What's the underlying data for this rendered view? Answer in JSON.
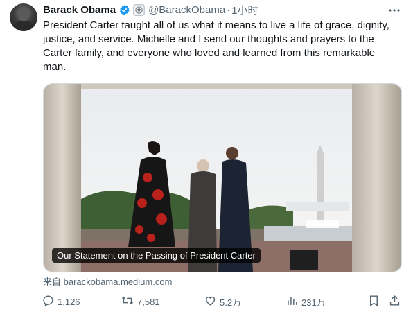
{
  "author": {
    "name": "Barack Obama",
    "handle": "@BarackObama",
    "time": "1小时"
  },
  "tweet": {
    "text": "President Carter taught all of us what it means to live a life of grace, dignity,\njustice, and service. Michelle and I send our thoughts and prayers to the\nCarter family, and everyone who loved and learned from this remarkable\nman."
  },
  "card": {
    "caption": "Our Statement on the Passing of President Carter",
    "source": "来自 barackobama.medium.com"
  },
  "actions": {
    "replies": "1,126",
    "reposts": "7,581",
    "likes": "5.2万",
    "views": "231万"
  },
  "colors": {
    "accent": "#1d9bf0",
    "muted": "#536471"
  },
  "icons": [
    "verified-badge-icon",
    "government-seal-icon",
    "more-icon",
    "reply-icon",
    "repost-icon",
    "like-icon",
    "views-icon",
    "bookmark-icon",
    "share-icon"
  ]
}
